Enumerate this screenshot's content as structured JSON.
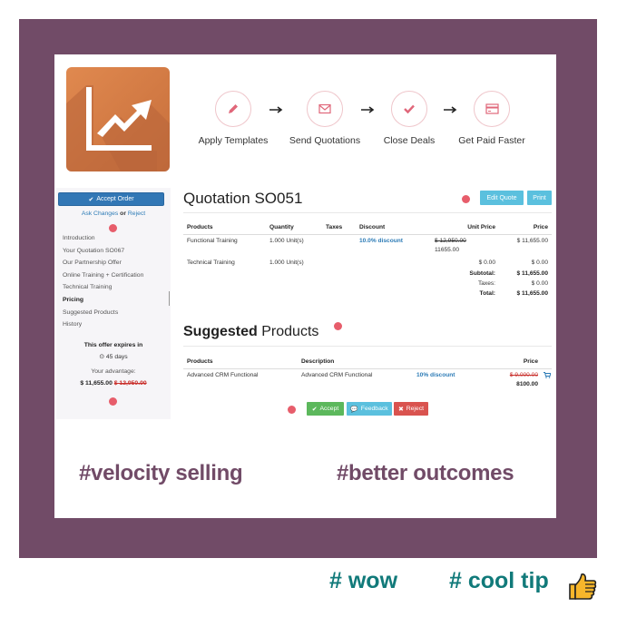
{
  "colors": {
    "frame": "#714b67",
    "logo": "#d27a44",
    "step_icon": "#e0677a",
    "primary": "#3277b5",
    "info": "#5bc0de",
    "success": "#5cb85c",
    "danger": "#d9534f",
    "link": "#2c7bb6",
    "hashtag": "#714b67",
    "footer_tag": "#117a7a",
    "marker_dot": "#e75d6b"
  },
  "app_icon": "sales-chart-icon",
  "steps": [
    {
      "label": "Apply Templates",
      "icon": "pencil-icon"
    },
    {
      "label": "Send Quotations",
      "icon": "envelope-icon"
    },
    {
      "label": "Close Deals",
      "icon": "checkmark-icon"
    },
    {
      "label": "Get Paid Faster",
      "icon": "credit-card-icon"
    }
  ],
  "sidebar": {
    "accept_order_label": "Accept Order",
    "ask_changes": "Ask Changes",
    "or": "or",
    "reject": "Reject",
    "nav": [
      {
        "label": "Introduction"
      },
      {
        "label": "Your Quotation SO067"
      },
      {
        "label": "Our Partnership Offer"
      },
      {
        "label": "Online Training + Certification"
      },
      {
        "label": "Technical Training"
      },
      {
        "label": "Pricing",
        "active": true
      },
      {
        "label": "Suggested Products"
      },
      {
        "label": "History"
      }
    ],
    "expires_title": "This offer expires in",
    "expires_days": "45 days",
    "advantage_label": "Your advantage:",
    "advantage_amount": "$ 11,655.00",
    "advantage_old": "$ 12,950.00"
  },
  "quotation": {
    "title_word": "Quotation",
    "number": "SO051",
    "edit_label": "Edit Quote",
    "print_label": "Print",
    "columns": [
      "Products",
      "Quantity",
      "Taxes",
      "Discount",
      "Unit Price",
      "Price"
    ],
    "rows": [
      {
        "product": "Functional Training",
        "quantity": "1.000 Unit(s)",
        "taxes": "",
        "discount": "10.0% discount",
        "unit_price_old": "$ 12,950.00",
        "unit_price": "11655.00",
        "price": "$ 11,655.00"
      },
      {
        "product": "Technical Training",
        "quantity": "1.000 Unit(s)",
        "taxes": "",
        "discount": "",
        "unit_price_old": "",
        "unit_price": "$ 0.00",
        "price": "$ 0.00"
      }
    ],
    "totals": [
      {
        "label": "Subtotal:",
        "value": "$ 11,655.00",
        "bold": true
      },
      {
        "label": "Taxes:",
        "value": "$ 0.00",
        "bold": false
      },
      {
        "label": "Total:",
        "value": "$ 11,655.00",
        "bold": true
      }
    ]
  },
  "suggested": {
    "title_bold": "Suggested",
    "title_rest": "Products",
    "columns": [
      "Products",
      "Description",
      "",
      "Price"
    ],
    "rows": [
      {
        "product": "Advanced CRM Functional",
        "description": "Advanced CRM Functional",
        "discount": "10% discount",
        "price_old": "$ 9,000.00",
        "price": "8100.00",
        "icon": "cart-icon"
      }
    ]
  },
  "actions": {
    "accept": "Accept",
    "feedback": "Feedback",
    "reject": "Reject"
  },
  "hashtags": {
    "left": "#velocity selling",
    "right": "#better outcomes"
  },
  "footer": {
    "wow": "# wow",
    "cool_tip": "# cool tip",
    "emoji": "thumbs-up-icon"
  }
}
